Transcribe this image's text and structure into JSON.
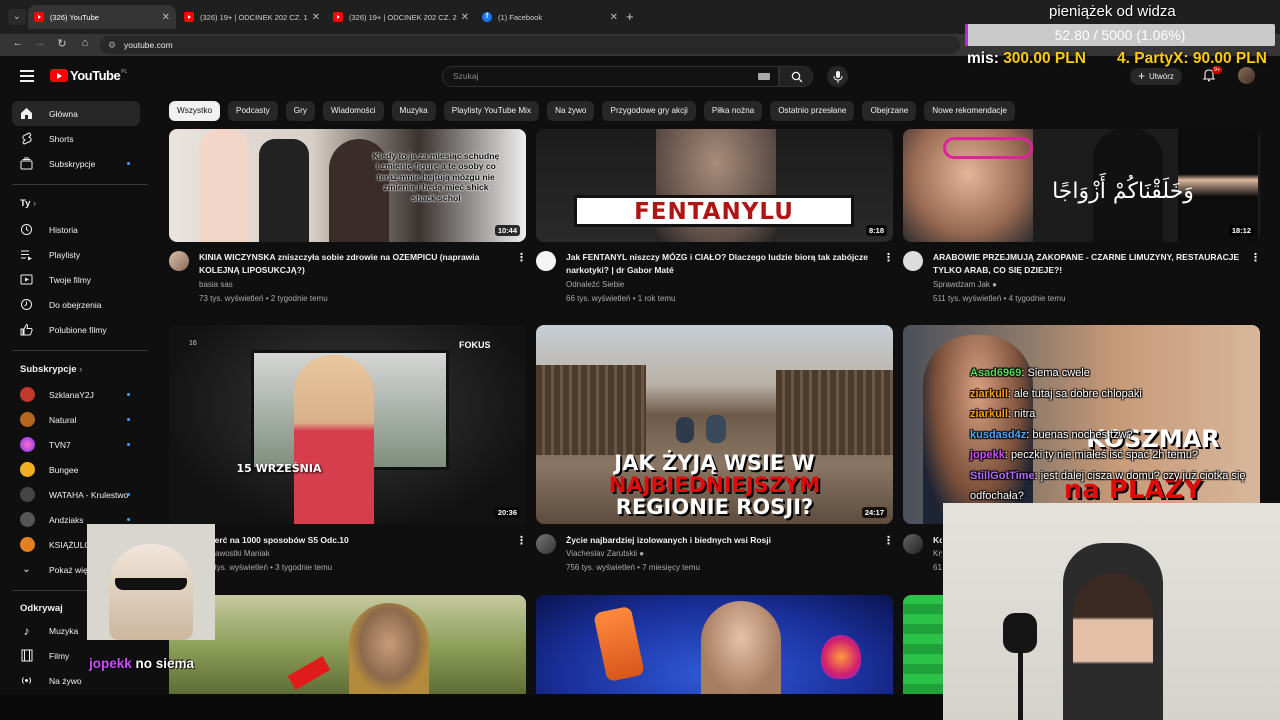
{
  "browser": {
    "tabs": [
      {
        "label": "(326) YouTube",
        "favicon": "youtube-icon",
        "active": true
      },
      {
        "label": "(326) 19+ | ODCINEK 202 CZ. 1",
        "favicon": "youtube-icon",
        "active": false
      },
      {
        "label": "(326) 19+ | ODCINEK 202 CZ. 2",
        "favicon": "youtube-icon",
        "active": false
      },
      {
        "label": "(1) Facebook",
        "favicon": "facebook-icon",
        "active": false
      }
    ],
    "close_glyph": "✕",
    "new_tab_glyph": "+",
    "url": "youtube.com"
  },
  "youtube": {
    "logo_text": "YouTube",
    "logo_country": "PL",
    "search_placeholder": "Szukaj",
    "create_label": "Utwórz",
    "notification_count": "9+",
    "chips": [
      "Wszystko",
      "Podcasty",
      "Gry",
      "Wiadomości",
      "Muzyka",
      "Playlisty YouTube Mix",
      "Na żywo",
      "Przygodowe gry akcji",
      "Piłka nożna",
      "Ostatnio przesłane",
      "Obejrzane",
      "Nowe rekomendacje"
    ],
    "sidebar": {
      "main": [
        {
          "label": "Główna",
          "icon": "home-icon"
        },
        {
          "label": "Shorts",
          "icon": "shorts-icon"
        },
        {
          "label": "Subskrypcje",
          "icon": "subscriptions-icon"
        }
      ],
      "you_heading": "Ty",
      "you": [
        {
          "label": "Historia",
          "icon": "history-icon"
        },
        {
          "label": "Playlisty",
          "icon": "playlist-icon"
        },
        {
          "label": "Twoje filmy",
          "icon": "your-videos-icon"
        },
        {
          "label": "Do obejrzenia",
          "icon": "watch-later-icon"
        },
        {
          "label": "Polubione filmy",
          "icon": "like-icon"
        }
      ],
      "subs_heading": "Subskrypcje",
      "subs": [
        {
          "label": "SzklanaY2J",
          "color": "#c0392b"
        },
        {
          "label": "Natural",
          "color": "#b5651d"
        },
        {
          "label": "TVN7",
          "color": "#e91e63"
        },
        {
          "label": "Bungee",
          "color": "#f2b01e"
        },
        {
          "label": "WATAHA - Krulestwo",
          "color": "#444444"
        },
        {
          "label": "Andziaks",
          "color": "#555555"
        },
        {
          "label": "KSIĄŻULO",
          "color": "#e67e22"
        },
        {
          "label": "Pokaż więcej",
          "icon": "chevron-down-icon"
        }
      ],
      "explore_heading": "Odkrywaj",
      "explore": [
        {
          "label": "Muzyka",
          "icon": "music-icon"
        },
        {
          "label": "Filmy",
          "icon": "film-icon"
        },
        {
          "label": "Na żywo",
          "icon": "live-icon"
        }
      ]
    },
    "videos": [
      {
        "title": "KINIA WICZYNSKA zniszczyła sobie zdrowie na OZEMPICU (naprawia KOLEJNĄ LIPOSUKCJĄ?)",
        "channel": "basia sas",
        "meta": "73 tys. wyświetleń • 2 tygodnie temu",
        "duration": "10:44",
        "overlay": "Kiedy to ja za miesiąc schudnę i zmienię figurę a te osoby co teraz mnie hejtują mózgu nie zmienią i będą mieć shick shack schol"
      },
      {
        "title": "Jak FENTANYL niszczy MÓZG i CIAŁO? Dlaczego ludzie biorą tak zabójcze narkotyki? | dr Gabor Maté",
        "channel": "Odnaleźć Siebie",
        "meta": "66 tys. wyświetleń • 1 rok temu",
        "duration": "8:18",
        "overlay": "FENTANYLU"
      },
      {
        "title": "ARABOWIE PRZEJMUJĄ ZAKOPANE - CZARNE LIMUZYNY, RESTAURACJE TYLKO ARAB, CO SIĘ DZIEJE?!",
        "channel": "Sprawdzam Jak",
        "meta": "511 tys. wyświetleń • 4 tygodnie temu",
        "duration": "18:12",
        "overlay": "وَخَلَقْنَاكُمْ أَزْوَاجًا"
      },
      {
        "title": "Śmierć na 1000 sposobów S5 Odc.10",
        "channel": "Ciekawostki Maniak",
        "meta": "154 tys. wyświetleń • 3 tygodnie temu",
        "duration": "20:36",
        "overlay": "15 WRZEŚNIA",
        "brand": "FOKUS"
      },
      {
        "title": "Życie najbardziej izolowanych i biednych wsi Rosji",
        "channel": "Viacheslav Zarutskii",
        "meta": "756 tys. wyświetleń • 7 miesięcy temu",
        "duration": "24:17",
        "overlay_line1": "JAK ŻYJĄ WSIE W",
        "overlay_line2": "NAJBIEDNIEJSZYM",
        "overlay_line3": "REGIONIE ROSJI?"
      },
      {
        "title": "Koszmar na plaży",
        "channel": "Kryminalne",
        "meta": "61 tys. wyświetleń",
        "duration": "",
        "overlay_line1": "KOSZMAR",
        "overlay_line2": "na PLAŻY"
      }
    ]
  },
  "stream": {
    "donation_title": "pieniążek od widza",
    "donation_progress_text": "52.80 / 5000 (1.06%)",
    "donation_progress": 0.0106,
    "month_label": "mis:",
    "month_value": "300.00 PLN",
    "top_label": "4. PartyX:",
    "top_value": "90.00 PLN",
    "chat": [
      {
        "user": "Asad6969",
        "color": "#55dd55",
        "message": ": Siema cwele"
      },
      {
        "user": "ziarkull",
        "color": "#ff9f1a",
        "message": ": ale tutaj sa dobre chlopaki"
      },
      {
        "user": "ziarkull",
        "color": "#ff9f1a",
        "message": ": nitra"
      },
      {
        "user": "kusdasd4z",
        "color": "#4da6ff",
        "message": ": buenas noches tzw?"
      },
      {
        "user": "jopekk",
        "color": "#d24bff",
        "message": ": peczki ty nie miałeś iść spać 2h temu?"
      },
      {
        "user": "StillGotTime",
        "color": "#b36bff",
        "message": ": jest dalej cisza w domu? czy już ciotka się odfochała?"
      }
    ],
    "cat_chat_user": "jopekk",
    "cat_chat_message": "no siema"
  }
}
